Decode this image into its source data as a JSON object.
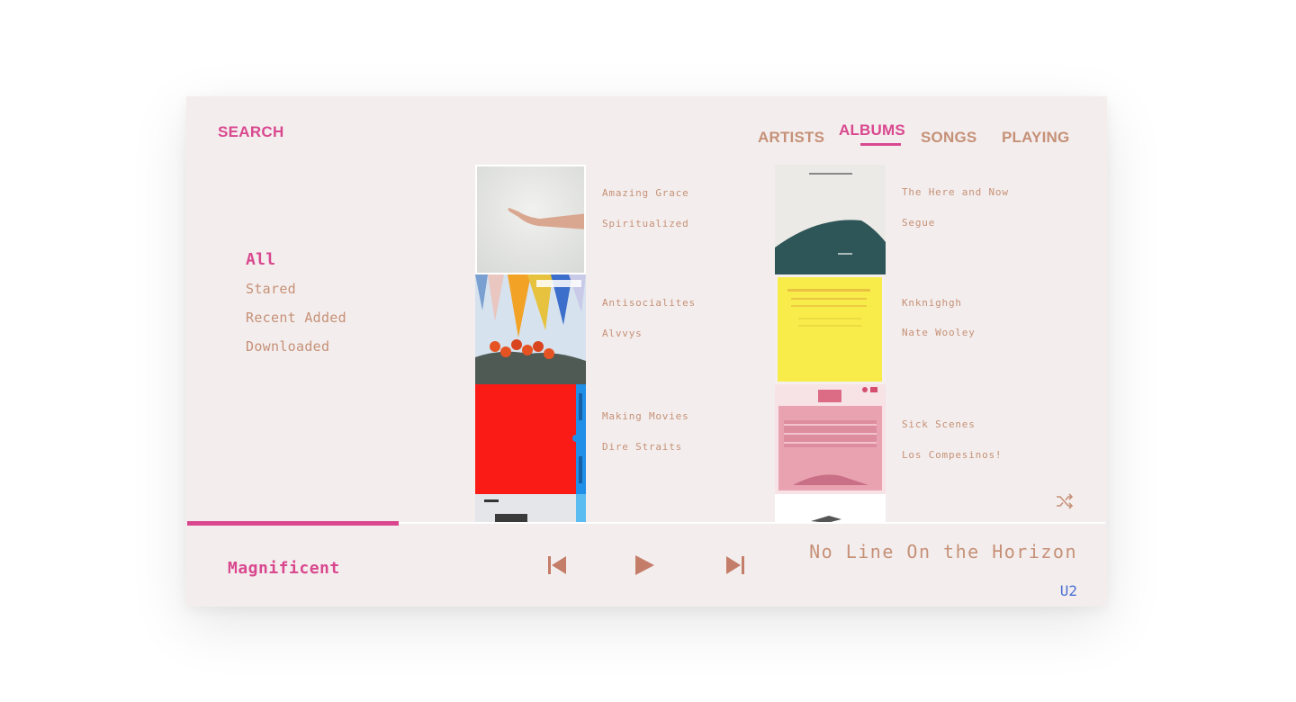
{
  "header": {
    "search_label": "SEARCH",
    "tabs": [
      {
        "label": "ARTISTS",
        "active": false
      },
      {
        "label": "ALBUMS",
        "active": true
      },
      {
        "label": "SONGS",
        "active": false
      },
      {
        "label": "PLAYING",
        "active": false
      }
    ]
  },
  "filters": [
    {
      "label": "All",
      "active": true
    },
    {
      "label": "Stared",
      "active": false
    },
    {
      "label": "Recent Added",
      "active": false
    },
    {
      "label": "Downloaded",
      "active": false
    }
  ],
  "albums": [
    {
      "title": "Amazing Grace",
      "artist": "Spiritualized"
    },
    {
      "title": "The Here and Now",
      "artist": "Segue"
    },
    {
      "title": "Antisocialites",
      "artist": "Alvvys"
    },
    {
      "title": "Knknighgh",
      "artist": "Nate Wooley"
    },
    {
      "title": "Making Movies",
      "artist": "Dire Straits"
    },
    {
      "title": "Sick Scenes",
      "artist": "Los Compesinos!"
    }
  ],
  "player": {
    "track_title": "Magnificent",
    "album_title": "No Line On the Horizon",
    "artist": "U2",
    "progress": 0.23,
    "icons": {
      "prev": "skip-previous-icon",
      "play": "play-icon",
      "next": "skip-next-icon",
      "shuffle": "shuffle-icon"
    }
  },
  "colors": {
    "accent": "#d9488f",
    "muted": "#c69077",
    "link": "#4a6fd4",
    "background": "#f3eeed"
  }
}
